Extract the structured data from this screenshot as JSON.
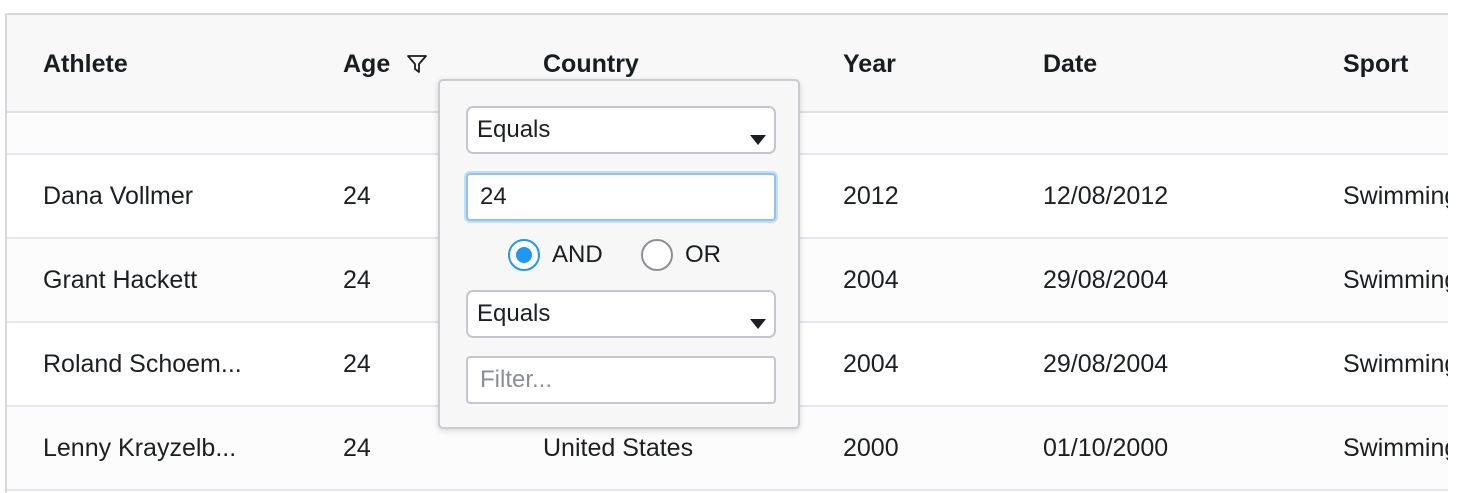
{
  "columns": [
    "Athlete",
    "Age",
    "Country",
    "Year",
    "Date",
    "Sport"
  ],
  "rows": [
    {
      "athlete": "Dana Vollmer",
      "age": "24",
      "country": "",
      "year": "2012",
      "date": "12/08/2012",
      "sport": "Swimming"
    },
    {
      "athlete": "Grant Hackett",
      "age": "24",
      "country": "",
      "year": "2004",
      "date": "29/08/2004",
      "sport": "Swimming"
    },
    {
      "athlete": "Roland Schoem...",
      "age": "24",
      "country": "",
      "year": "2004",
      "date": "29/08/2004",
      "sport": "Swimming"
    },
    {
      "athlete": "Lenny Krayzelb...",
      "age": "24",
      "country": "United States",
      "year": "2000",
      "date": "01/10/2000",
      "sport": "Swimming"
    }
  ],
  "filter": {
    "condition1": "Equals",
    "value1": "24",
    "join_and": "AND",
    "join_or": "OR",
    "join_selected": "AND",
    "condition2": "Equals",
    "placeholder2": "Filter..."
  },
  "icons": {
    "filter": "filter-icon",
    "dropdown": "caret-down-icon"
  },
  "colors": {
    "accent": "#2196f3",
    "header_bg": "#f8f8f8"
  }
}
